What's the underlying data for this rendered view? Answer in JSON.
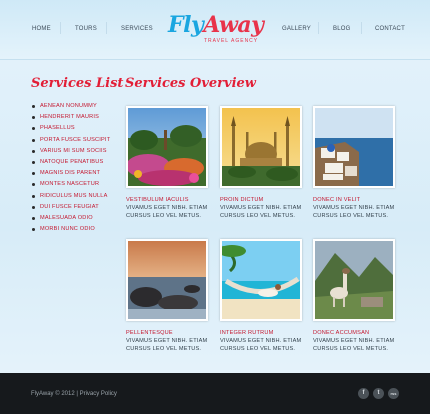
{
  "nav": {
    "items": [
      "HOME",
      "TOURS",
      "SERVICES",
      "GALLERY",
      "BLOG",
      "CONTACT"
    ]
  },
  "logo": {
    "fly": "Fly",
    "away": "Away",
    "tagline": "TRAVEL AGENCY"
  },
  "sidebar": {
    "title": "Services List",
    "items": [
      "AENEAN NONUMMY",
      "HENDRERIT MAURIS",
      "PHASELLUS",
      "PORTA FUSCE SUSCIPIT",
      "VARIUS MI SUM SOCIIS",
      "NATOQUE PENATIBUS",
      "MAGNIS DIS PARENT",
      "MONTES NASCETUR",
      "RIDICULUS MUS NULLA",
      "DUI FUSCE FEUGIAT",
      "MALESUADA ODIO",
      "MORBI NUNC ODIO"
    ]
  },
  "main": {
    "title": "Services Overview",
    "cards": [
      {
        "title": "VESTIBULUM IACULIS",
        "line1": "VIVAMUS EGET NIBH. ETIAM",
        "line2": "CURSUS LEO VEL METUS."
      },
      {
        "title": "PROIN DICTUM",
        "line1": "VIVAMUS EGET NIBH. ETIAM",
        "line2": "CURSUS LEO VEL METUS."
      },
      {
        "title": "DONEC IN VELIT",
        "line1": "VIVAMUS EGET NIBH. ETIAM",
        "line2": "CURSUS LEO VEL METUS."
      },
      {
        "title": "PELLENTESQUE",
        "line1": "VIVAMUS EGET NIBH. ETIAM",
        "line2": "CURSUS LEO VEL METUS."
      },
      {
        "title": "INTEGER RUTRUM",
        "line1": "VIVAMUS EGET NIBH. ETIAM",
        "line2": "CURSUS LEO VEL METUS."
      },
      {
        "title": "DONEC ACCUMSAN",
        "line1": "VIVAMUS EGET NIBH. ETIAM",
        "line2": "CURSUS LEO VEL METUS."
      }
    ]
  },
  "footer": {
    "copyright": "FlyAway © 2012 |",
    "privacy": "Privacy Policy",
    "social": [
      "f",
      "t",
      "rss"
    ]
  },
  "colors": {
    "accent": "#e21e36",
    "brand_blue": "#1aa6e0",
    "footer_bg": "#16191c"
  }
}
